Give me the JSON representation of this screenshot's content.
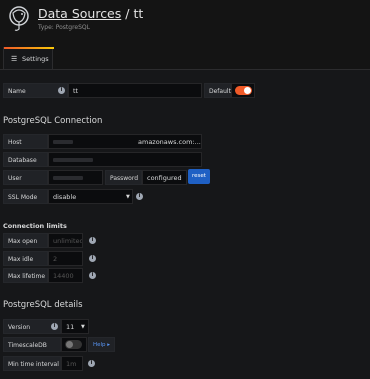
{
  "header": {
    "title_link": "Data Sources",
    "title_sep": " / ",
    "title_name": "tt",
    "subtitle": "Type: PostgreSQL",
    "logo_icon": "postgresql-elephant-icon"
  },
  "tabs": [
    {
      "label": "Settings",
      "icon": "sliders-icon",
      "active": true
    }
  ],
  "settings": {
    "name_label": "Name",
    "name_value": "tt",
    "default_label": "Default",
    "default_on": true
  },
  "connection": {
    "heading": "PostgreSQL Connection",
    "host_label": "Host",
    "host_value": "amazonaws.com:...",
    "database_label": "Database",
    "user_label": "User",
    "password_label": "Password",
    "password_value": "configured",
    "reset_label": "reset",
    "sslmode_label": "SSL Mode",
    "sslmode_value": "disable"
  },
  "limits": {
    "heading": "Connection limits",
    "max_open_label": "Max open",
    "max_open_placeholder": "unlimited",
    "max_idle_label": "Max idle",
    "max_idle_placeholder": "2",
    "max_lifetime_label": "Max lifetime",
    "max_lifetime_placeholder": "14400"
  },
  "details": {
    "heading": "PostgreSQL details",
    "version_label": "Version",
    "version_value": "11",
    "timescale_label": "TimescaleDB",
    "timescale_on": false,
    "help_label": "Help ▸",
    "min_interval_label": "Min time interval",
    "min_interval_placeholder": "1m"
  },
  "colors": {
    "accent": "#f05a28",
    "primary_button": "#1f60c4",
    "background": "#161719"
  }
}
